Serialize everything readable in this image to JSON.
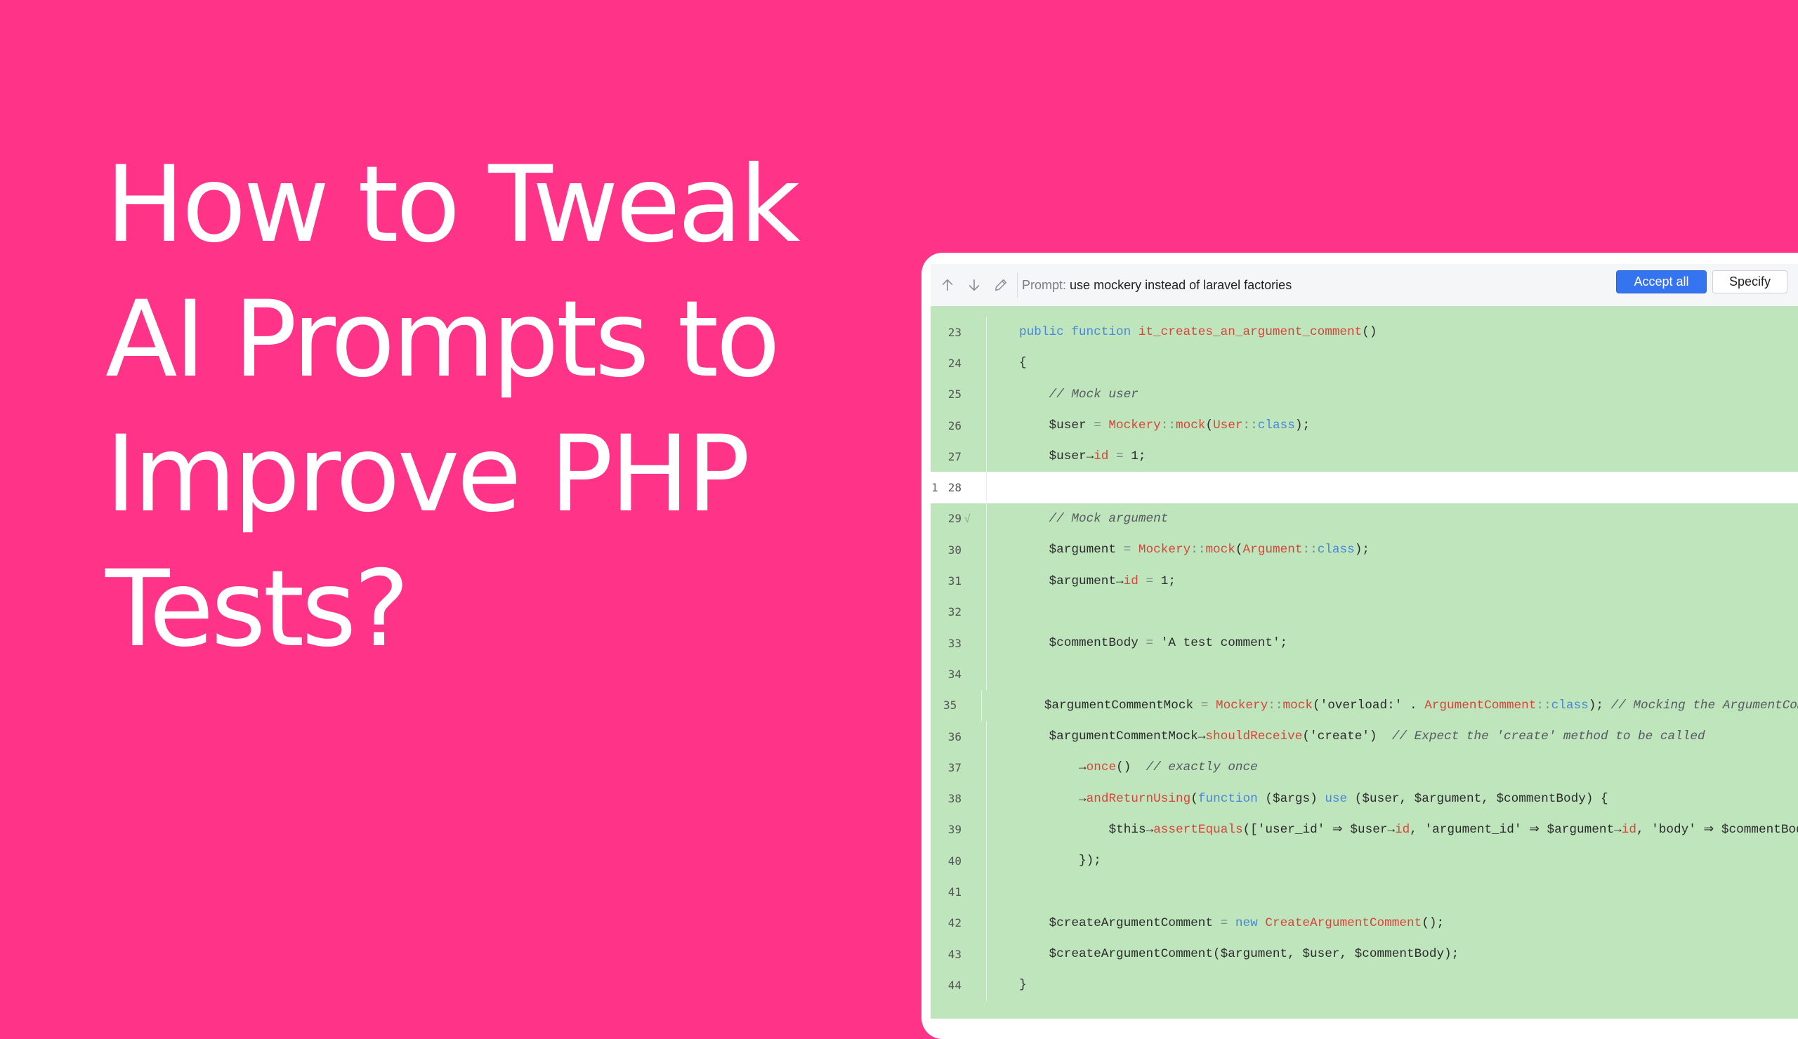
{
  "headline": {
    "lines": [
      "How to Tweak",
      "AI Prompts to",
      "Improve PHP",
      "Tests?"
    ]
  },
  "editor": {
    "toolbar": {
      "icons": [
        "arrow-up-icon",
        "arrow-down-icon",
        "pencil-icon"
      ],
      "prompt_label": "Prompt:",
      "prompt_text": "use mockery instead of laravel factories",
      "accept_all_label": "Accept all",
      "specify_label": "Specify"
    },
    "colors": {
      "background": "#ff3388",
      "added_line_bg": "#bfe5bd",
      "accept_button": "#3574f0",
      "keyword": "#4a86d6",
      "identifier": "#d6453a",
      "comment": "#555a5f"
    },
    "lines": [
      {
        "num": "23",
        "added": true,
        "indent": 1,
        "tokens": [
          [
            "kw",
            "public "
          ],
          [
            "kw",
            "function "
          ],
          [
            "fn",
            "it_creates_an_argument_comment"
          ],
          [
            "tx",
            "()"
          ]
        ]
      },
      {
        "num": "24",
        "added": true,
        "indent": 1,
        "tokens": [
          [
            "tx",
            "{"
          ]
        ]
      },
      {
        "num": "25",
        "added": true,
        "indent": 2,
        "tokens": [
          [
            "cm",
            "// Mock user"
          ]
        ]
      },
      {
        "num": "26",
        "added": true,
        "indent": 2,
        "tokens": [
          [
            "tx",
            "$user "
          ],
          [
            "op",
            "= "
          ],
          [
            "fn",
            "Mockery"
          ],
          [
            "op",
            "::"
          ],
          [
            "fn",
            "mock"
          ],
          [
            "tx",
            "("
          ],
          [
            "fn",
            "User"
          ],
          [
            "op",
            "::"
          ],
          [
            "kw",
            "class"
          ],
          [
            "tx",
            ");"
          ]
        ]
      },
      {
        "num": "27",
        "added": true,
        "indent": 2,
        "tokens": [
          [
            "tx",
            "$user→"
          ],
          [
            "fn",
            "id"
          ],
          [
            "op",
            " = "
          ],
          [
            "tx",
            "1;"
          ]
        ]
      },
      {
        "num": "28",
        "marker": "1",
        "added": false,
        "indent": 0,
        "tokens": []
      },
      {
        "num": "29",
        "check": true,
        "added": true,
        "indent": 2,
        "tokens": [
          [
            "cm",
            "// Mock argument"
          ]
        ]
      },
      {
        "num": "30",
        "added": true,
        "indent": 2,
        "tokens": [
          [
            "tx",
            "$argument "
          ],
          [
            "op",
            "= "
          ],
          [
            "fn",
            "Mockery"
          ],
          [
            "op",
            "::"
          ],
          [
            "fn",
            "mock"
          ],
          [
            "tx",
            "("
          ],
          [
            "fn",
            "Argument"
          ],
          [
            "op",
            "::"
          ],
          [
            "kw",
            "class"
          ],
          [
            "tx",
            ");"
          ]
        ]
      },
      {
        "num": "31",
        "added": true,
        "indent": 2,
        "tokens": [
          [
            "tx",
            "$argument→"
          ],
          [
            "fn",
            "id"
          ],
          [
            "op",
            " = "
          ],
          [
            "tx",
            "1;"
          ]
        ]
      },
      {
        "num": "32",
        "added": true,
        "indent": 0,
        "tokens": []
      },
      {
        "num": "33",
        "added": true,
        "indent": 2,
        "tokens": [
          [
            "tx",
            "$commentBody "
          ],
          [
            "op",
            "= "
          ],
          [
            "tx",
            "'A test comment';"
          ]
        ]
      },
      {
        "num": "34",
        "added": true,
        "indent": 0,
        "tokens": []
      },
      {
        "num": "35",
        "added": true,
        "indent": 2,
        "tokens": [
          [
            "tx",
            "$argumentCommentMock "
          ],
          [
            "op",
            "= "
          ],
          [
            "fn",
            "Mockery"
          ],
          [
            "op",
            "::"
          ],
          [
            "fn",
            "mock"
          ],
          [
            "tx",
            "('overload:' . "
          ],
          [
            "fn",
            "ArgumentComment"
          ],
          [
            "op",
            "::"
          ],
          [
            "kw",
            "class"
          ],
          [
            "tx",
            "); "
          ],
          [
            "cm",
            "// Mocking the ArgumentComment"
          ]
        ]
      },
      {
        "num": "36",
        "added": true,
        "indent": 2,
        "tokens": [
          [
            "tx",
            "$argumentCommentMock→"
          ],
          [
            "fn",
            "shouldReceive"
          ],
          [
            "tx",
            "('create')  "
          ],
          [
            "cm",
            "// Expect the 'create' method to be called"
          ]
        ]
      },
      {
        "num": "37",
        "added": true,
        "indent": 3,
        "tokens": [
          [
            "tx",
            "→"
          ],
          [
            "fn",
            "once"
          ],
          [
            "tx",
            "()  "
          ],
          [
            "cm",
            "// exactly once"
          ]
        ]
      },
      {
        "num": "38",
        "added": true,
        "indent": 3,
        "tokens": [
          [
            "tx",
            "→"
          ],
          [
            "fn",
            "andReturnUsing"
          ],
          [
            "tx",
            "("
          ],
          [
            "kw",
            "function"
          ],
          [
            "tx",
            " ($args) "
          ],
          [
            "kw",
            "use"
          ],
          [
            "tx",
            " ($user, $argument, $commentBody) {"
          ]
        ]
      },
      {
        "num": "39",
        "added": true,
        "indent": 4,
        "tokens": [
          [
            "tx",
            "$this→"
          ],
          [
            "fn",
            "assertEquals"
          ],
          [
            "tx",
            "(['user_id' ⇒ $user→"
          ],
          [
            "fn",
            "id"
          ],
          [
            "tx",
            ", 'argument_id' ⇒ $argument→"
          ],
          [
            "fn",
            "id"
          ],
          [
            "tx",
            ", 'body' ⇒ $commentBody"
          ]
        ]
      },
      {
        "num": "40",
        "added": true,
        "indent": 3,
        "tokens": [
          [
            "tx",
            "});"
          ]
        ]
      },
      {
        "num": "41",
        "added": true,
        "indent": 0,
        "tokens": []
      },
      {
        "num": "42",
        "added": true,
        "indent": 2,
        "tokens": [
          [
            "tx",
            "$createArgumentComment "
          ],
          [
            "op",
            "= "
          ],
          [
            "kw",
            "new "
          ],
          [
            "fn",
            "CreateArgumentComment"
          ],
          [
            "tx",
            "();"
          ]
        ]
      },
      {
        "num": "43",
        "added": true,
        "indent": 2,
        "tokens": [
          [
            "tx",
            "$createArgumentComment($argument, $user, $commentBody);"
          ]
        ]
      },
      {
        "num": "44",
        "added": true,
        "indent": 1,
        "tokens": [
          [
            "tx",
            "}"
          ]
        ]
      }
    ]
  }
}
